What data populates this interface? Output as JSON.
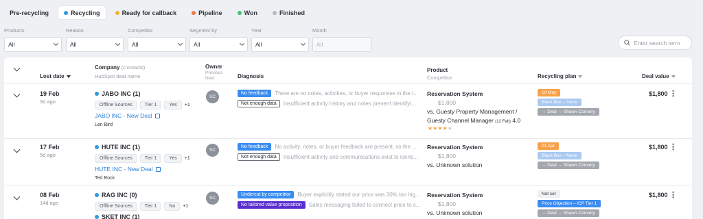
{
  "tabs": [
    {
      "label": "Pre-recycling",
      "dot": null,
      "active": false
    },
    {
      "label": "Recycling",
      "dot": "#2f9bd9",
      "active": true
    },
    {
      "label": "Ready for callback",
      "dot": "#f2b430",
      "active": false
    },
    {
      "label": "Pipeline",
      "dot": "#f07a4a",
      "active": false
    },
    {
      "label": "Won",
      "dot": "#3cc46b",
      "active": false
    },
    {
      "label": "Finished",
      "dot": "#b4b8be",
      "active": false
    }
  ],
  "filters": {
    "products": {
      "label": "Products",
      "value": "All"
    },
    "reason": {
      "label": "Reason",
      "value": "All"
    },
    "competitor": {
      "label": "Competitor",
      "value": "All"
    },
    "segment": {
      "label": "Segment by",
      "value": "All"
    },
    "year": {
      "label": "Year",
      "value": "All"
    },
    "month": {
      "label": "Month",
      "value": "All"
    }
  },
  "search": {
    "placeholder": "Enter search term"
  },
  "columns": {
    "lost_date": "Lost date",
    "company": "Company",
    "company_sub": "(Contacts)",
    "company_sub2": "HubSpot deal name",
    "owner": "Owner",
    "owner_sub": "Previous",
    "owner_sub2": "Next",
    "diagnosis": "Diagnosis",
    "product": "Product",
    "product_sub": "Competitor",
    "recycling_plan": "Recycling plan",
    "deal_value": "Deal value"
  },
  "rows": [
    {
      "date": "19 Feb",
      "ago": "3d ago",
      "company": "JABO INC (1)",
      "chips": [
        "Offline Sources",
        "Tier 1",
        "Yes"
      ],
      "more": "+1",
      "deal": "JABO INC - New Deal",
      "contact": "Len Bird",
      "owner": "SC",
      "diag1_badge": "No feedback",
      "diag1_text": "There are no notes, activities, or buyer responses in the r...",
      "diag2_badge": "Not enough data",
      "diag2_text": "Insufficient activity history and notes prevent identifyi...",
      "product": "Reservation System",
      "price": "$1,800",
      "competitor": "vs. Guesty Property Management / Guesty Channel Manager",
      "competitor_note": "(12 Feb)",
      "competitor_rating": "4.0",
      "stars": "★★★★",
      "stars_off": "★",
      "plan1": "19 May",
      "plan2": "Black Box – None",
      "plan3": "→ Deal → Shawn Convery",
      "value": "$1,800"
    },
    {
      "date": "17 Feb",
      "ago": "5d ago",
      "company": "HUTE INC (1)",
      "chips": [
        "Offline Sources",
        "Tier 1",
        "Yes"
      ],
      "more": "+1",
      "deal": "HUTE INC - New Deal",
      "contact": "Ted Rock",
      "owner": "SC",
      "diag1_badge": "No feedback",
      "diag1_text": "No activity, notes, or buyer feedback are present, so the ...",
      "diag2_badge": "Not enough data",
      "diag2_text": "Insufficient activity and communications exist to identi...",
      "product": "Reservation System",
      "price": "$1,800",
      "competitor": "vs. Unknown solution",
      "plan1": "01 Apr",
      "plan2": "Black Box – None",
      "plan3": "→ Deal → Shawn Convery",
      "value": "$1,800"
    },
    {
      "date": "08 Feb",
      "ago": "14d ago",
      "company": "RAG INC (0)",
      "company2": "SKET INC (1)",
      "chips": [
        "Offline Sources",
        "Tier 1",
        "No"
      ],
      "more": "+1",
      "owner": "SC",
      "diag1_badge": "Undercut by competitor",
      "diag1_text": "Buyer explicitly stated our price was 30% too hig...",
      "diag2_badge": "No tailored value proposition",
      "diag2_text": "Sales messaging failed to connect price to c...",
      "product": "Reservation System",
      "price": "$1,800",
      "competitor": "vs. Unknown solution",
      "plan1": "Not set",
      "plan2": "Price Objection – ICP Tier 1",
      "plan3": "→ Deal → Shawn Convery",
      "value": "$1,800"
    }
  ]
}
